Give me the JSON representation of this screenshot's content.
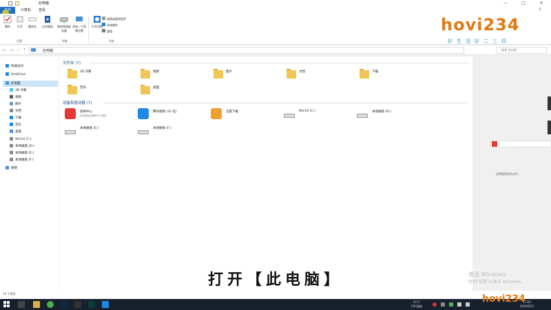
{
  "window": {
    "title": "此电脑",
    "min": "—",
    "max": "□",
    "close": "✕",
    "help": "?"
  },
  "tabs": {
    "file": "文件",
    "computer": "计算机",
    "view": "查看"
  },
  "ribbon": {
    "properties": "属性",
    "open": "打开",
    "rename": "重命名",
    "access_media": "访问媒体",
    "map_drive": "映射网络驱动器",
    "add_location": "添加一个网络位置",
    "open_settings": "打开设置",
    "uninstall": "卸载或更改程序",
    "system_properties": "系统属性",
    "manage": "管理",
    "group_location": "位置",
    "group_network": "网络",
    "group_system": "系统"
  },
  "address": {
    "path": "此电脑",
    "search_placeholder": "搜索\"此电脑\""
  },
  "logo": {
    "main": "hovi234",
    "sub": "好生活好二三四"
  },
  "sidebar": {
    "items": [
      {
        "label": "快速访问",
        "icon": "star-icon",
        "color": "#1e88e5"
      },
      {
        "label": "OneDrive",
        "icon": "cloud-icon",
        "color": "#1e88e5"
      },
      {
        "label": "此电脑",
        "icon": "computer-icon",
        "color": "#4a90d9"
      },
      {
        "label": "3D 对象",
        "icon": "cube-icon",
        "color": "#4fc3f7"
      },
      {
        "label": "视频",
        "icon": "video-icon",
        "color": "#555"
      },
      {
        "label": "图片",
        "icon": "picture-icon",
        "color": "#5c9fd6"
      },
      {
        "label": "文档",
        "icon": "document-icon",
        "color": "#888"
      },
      {
        "label": "下载",
        "icon": "download-icon",
        "color": "#1e88e5"
      },
      {
        "label": "音乐",
        "icon": "music-icon",
        "color": "#1e88e5"
      },
      {
        "label": "桌面",
        "icon": "desktop-icon",
        "color": "#4a90d9"
      },
      {
        "label": "Win10 (C:)",
        "icon": "drive-icon",
        "color": "#888"
      },
      {
        "label": "本地磁盘 (D:)",
        "icon": "drive-icon",
        "color": "#888"
      },
      {
        "label": "本地磁盘 (E:)",
        "icon": "drive-icon",
        "color": "#888"
      },
      {
        "label": "本地磁盘 (F:)",
        "icon": "drive-icon",
        "color": "#888"
      },
      {
        "label": "网络",
        "icon": "network-icon",
        "color": "#4a90d9"
      }
    ]
  },
  "main": {
    "folders_title": "文件夹 (7)",
    "folders": [
      "3D 对象",
      "视频",
      "图片",
      "文档",
      "下载",
      "音乐",
      "桌面"
    ],
    "devices_title": "设备和驱动器 (7)",
    "devices": [
      {
        "name": "爱奇中心",
        "sub": "双击更新由爱奇中心提供"
      },
      {
        "name": "腾讯视频 (32 位)",
        "sub": ""
      },
      {
        "name": "迅雷下载",
        "sub": ""
      },
      {
        "name": "Win10 (C:)",
        "sub": ""
      },
      {
        "name": "本地磁盘 (D:)",
        "sub": ""
      },
      {
        "name": "本地磁盘 (E:)",
        "sub": ""
      },
      {
        "name": "本地磁盘 (F:)",
        "sub": ""
      }
    ]
  },
  "preview": {
    "text": "选择要预览的文件。"
  },
  "status": {
    "count": "14 个项目"
  },
  "caption": "打开【此电脑】",
  "watermark": {
    "line1": "激活 Windows",
    "line2": "转到\"设置\"以激活 Windows。"
  },
  "tray": {
    "temp": "41°C",
    "temp_label": "CPU温度",
    "time": "17:03",
    "date": "2020/6/11"
  },
  "colors": {
    "accent": "#1f6fc7",
    "taskbar": "#17202d",
    "folder": "#f0c656"
  }
}
